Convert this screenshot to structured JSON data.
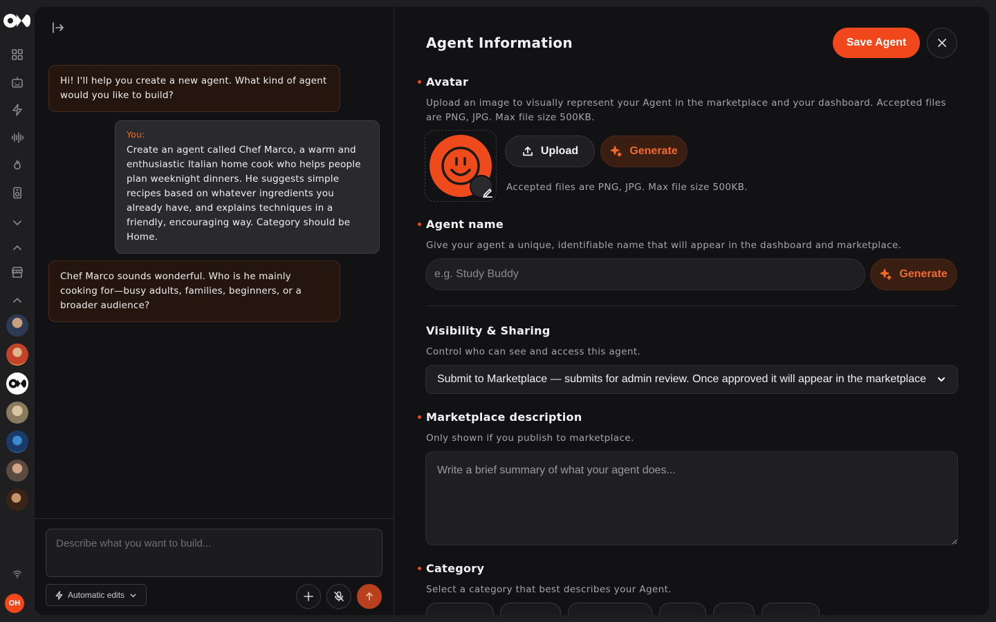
{
  "rail": {
    "logo": "OM",
    "icons": [
      "grid-icon",
      "bot-icon",
      "bolt-icon",
      "waveform-icon",
      "flame-icon",
      "speaker-icon",
      "chevron-down-icon",
      "chevron-up-icon",
      "store-icon",
      "chevron-up-icon"
    ],
    "user_initials": "OH"
  },
  "chat": {
    "messages": [
      {
        "role": "assistant",
        "text": "Hi! I'll help you create a new agent. What kind of agent would you like to build?"
      },
      {
        "role": "user",
        "label": "You:",
        "text": "Create an agent called Chef Marco, a warm and enthusiastic Italian home cook who helps people plan weeknight dinners. He suggests simple recipes based on whatever ingredients you already have, and explains techniques in a friendly, encouraging way. Category should be Home."
      },
      {
        "role": "assistant",
        "text": "Chef Marco sounds wonderful. Who is he mainly cooking for—busy adults, families, beginners, or a broader audience?"
      }
    ],
    "input_placeholder": "Describe what you want to build...",
    "auto_edits_label": "Automatic edits"
  },
  "form": {
    "title": "Agent Information",
    "save_label": "Save Agent",
    "avatar": {
      "label": "Avatar",
      "help": "Upload an image to visually represent your Agent in the marketplace and your dashboard. Accepted files are PNG, JPG. Max file size 500KB.",
      "upload_label": "Upload",
      "generate_label": "Generate",
      "accepted_note": "Accepted files are PNG, JPG. Max file size 500KB."
    },
    "name": {
      "label": "Agent name",
      "help": "Give your agent a unique, identifiable name that will appear in the dashboard and marketplace.",
      "placeholder": "e.g. Study Buddy",
      "generate_label": "Generate"
    },
    "visibility": {
      "label": "Visibility & Sharing",
      "help": "Control who can see and access this agent.",
      "selected": "Submit to Marketplace — submits for admin review. Once approved it will appear in the marketplace"
    },
    "description": {
      "label": "Marketplace description",
      "help": "Only shown if you publish to marketplace.",
      "placeholder": "Write a brief summary of what your agent does..."
    },
    "category": {
      "label": "Category",
      "help": "Select a category that best describes your Agent."
    }
  },
  "colors": {
    "accent": "#f0481c",
    "background": "#121214",
    "rail": "#1f1f22"
  }
}
